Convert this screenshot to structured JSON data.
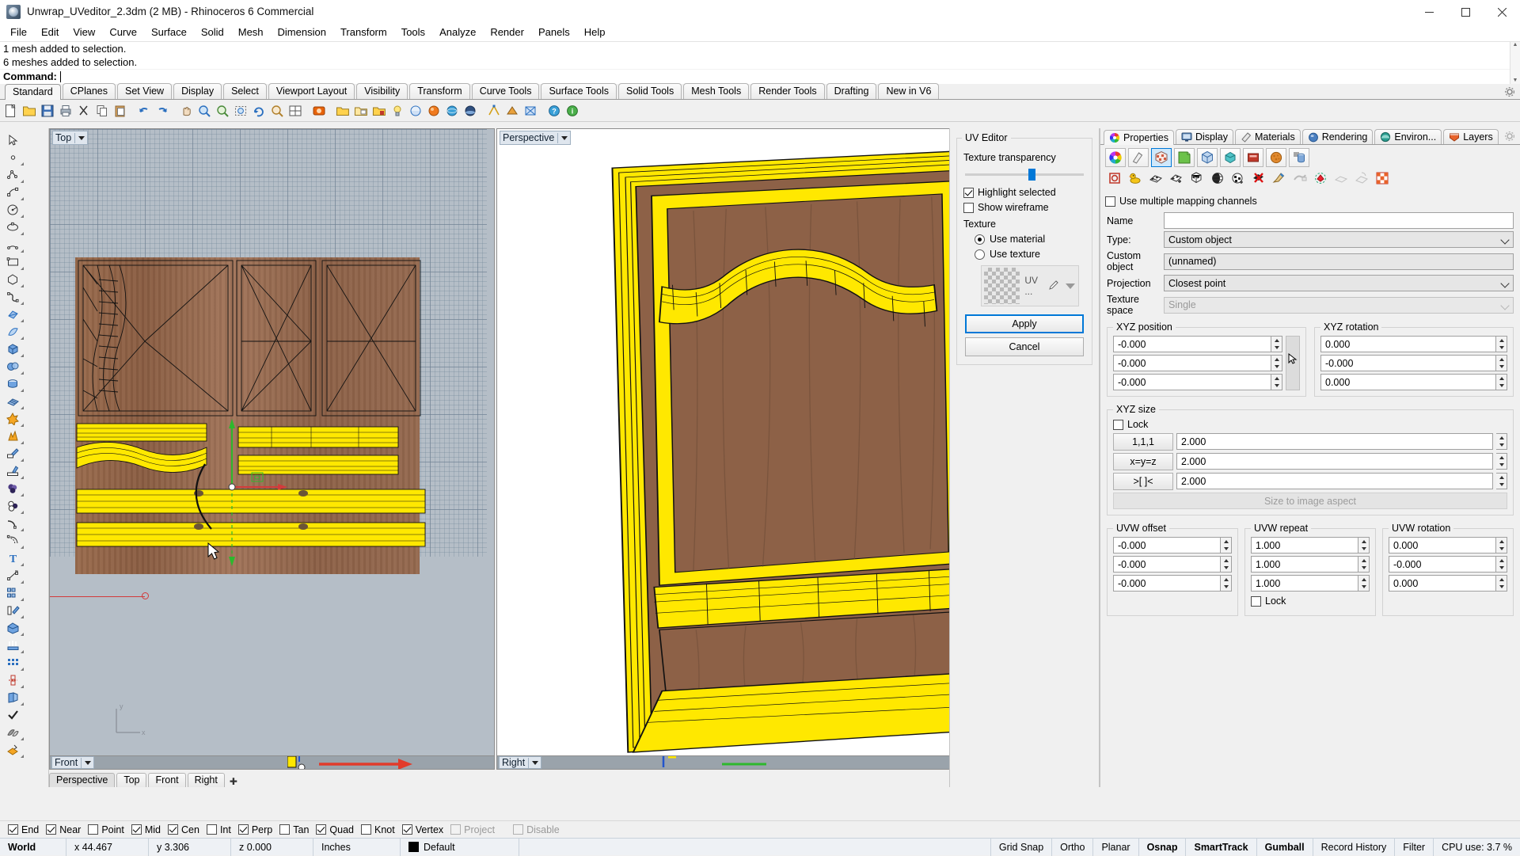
{
  "window": {
    "title": "Unwrap_UVeditor_2.3dm (2 MB) - Rhinoceros 6 Commercial",
    "minimize": "—",
    "maximize": "▭",
    "close": "✕",
    "app_icon": "rhino-logo-icon"
  },
  "menu": [
    "File",
    "Edit",
    "View",
    "Curve",
    "Surface",
    "Solid",
    "Mesh",
    "Dimension",
    "Transform",
    "Tools",
    "Analyze",
    "Render",
    "Panels",
    "Help"
  ],
  "command": {
    "history": [
      "1 mesh added to selection.",
      "6 meshes added to selection."
    ],
    "prompt_label": "Command:",
    "prompt_value": ""
  },
  "toolbar_tabs": [
    {
      "label": "Standard",
      "active": true
    },
    {
      "label": "CPlanes",
      "active": false
    },
    {
      "label": "Set View",
      "active": false
    },
    {
      "label": "Display",
      "active": false
    },
    {
      "label": "Select",
      "active": false
    },
    {
      "label": "Viewport Layout",
      "active": false
    },
    {
      "label": "Visibility",
      "active": false
    },
    {
      "label": "Transform",
      "active": false
    },
    {
      "label": "Curve Tools",
      "active": false
    },
    {
      "label": "Surface Tools",
      "active": false
    },
    {
      "label": "Solid Tools",
      "active": false
    },
    {
      "label": "Mesh Tools",
      "active": false
    },
    {
      "label": "Render Tools",
      "active": false
    },
    {
      "label": "Drafting",
      "active": false
    },
    {
      "label": "New in V6",
      "active": false
    }
  ],
  "viewports": {
    "top_left": {
      "label": "Top"
    },
    "top_right": {
      "label": "Perspective"
    },
    "bottom_left": {
      "label": "Front"
    },
    "bottom_right": {
      "label": "Right"
    },
    "tabs": [
      {
        "label": "Perspective",
        "active": true
      },
      {
        "label": "Top",
        "active": false
      },
      {
        "label": "Front",
        "active": false
      },
      {
        "label": "Right",
        "active": false
      }
    ],
    "add_tab": "✚"
  },
  "uv_editor": {
    "title": "UV Editor",
    "texture_transparency_label": "Texture transparency",
    "texture_transparency_value": 53,
    "highlight_selected": {
      "label": "Highlight selected",
      "checked": true
    },
    "show_wireframe": {
      "label": "Show wireframe",
      "checked": false
    },
    "texture_label": "Texture",
    "use_material": {
      "label": "Use material",
      "selected": true
    },
    "use_texture": {
      "label": "Use texture",
      "selected": false
    },
    "texture_swatch_label": "UV ...",
    "apply_button": "Apply",
    "cancel_button": "Cancel"
  },
  "properties": {
    "tabs": [
      {
        "label": "Properties",
        "icon": "color-wheel-icon",
        "active": true
      },
      {
        "label": "Display",
        "icon": "monitor-icon",
        "active": false
      },
      {
        "label": "Materials",
        "icon": "eraser-icon",
        "active": false
      },
      {
        "label": "Rendering",
        "icon": "sphere-icon",
        "active": false
      },
      {
        "label": "Environ...",
        "icon": "environment-icon",
        "active": false
      },
      {
        "label": "Layers",
        "icon": "layers-icon",
        "active": false
      }
    ],
    "gear_icon": "gear-icon",
    "icon_row_1": [
      {
        "name": "color-wheel-icon",
        "selected": false
      },
      {
        "name": "material-brush-icon",
        "selected": false
      },
      {
        "name": "texture-mapping-icon",
        "selected": true
      },
      {
        "name": "display-page-icon",
        "selected": false
      },
      {
        "name": "object-box-icon",
        "selected": false
      },
      {
        "name": "mesh-icon",
        "selected": false
      },
      {
        "name": "light-box-icon",
        "selected": false
      },
      {
        "name": "texture-ball-icon",
        "selected": false
      },
      {
        "name": "cylinder-detail-icon",
        "selected": false
      }
    ],
    "icon_row_2": [
      "mapping-widget-icon",
      "duck-surface-icon",
      "planar-mapping-icon",
      "box-mapping-icon",
      "cube-mapping-icon",
      "spherical-mapping-icon",
      "cylindrical-mapping-icon",
      "remove-mapping-icon",
      "paint-mapping-icon",
      "unwrap-icon",
      "uv-editor-icon",
      "flatten-icon",
      "apply-uv-icon",
      "checker-icon"
    ],
    "use_multiple_channels": {
      "label": "Use multiple mapping channels",
      "checked": false
    },
    "fields": {
      "name_label": "Name",
      "name_value": "",
      "name_placeholder": "",
      "type_label": "Type:",
      "type_value": "Custom object",
      "custom_object_label": "Custom object",
      "custom_object_value": "(unnamed)",
      "projection_label": "Projection",
      "projection_value": "Closest point",
      "texture_space_label": "Texture space",
      "texture_space_value": "Single",
      "texture_space_disabled": true
    },
    "xyz_position": {
      "title": "XYZ position",
      "values": [
        "-0.000",
        "-0.000",
        "-0.000"
      ]
    },
    "xyz_rotation": {
      "title": "XYZ rotation",
      "values": [
        "0.000",
        "-0.000",
        "0.000"
      ]
    },
    "xyz_size": {
      "title": "XYZ size",
      "lock_label": "Lock",
      "lock_checked": false,
      "buttons": [
        "1,1,1",
        "x=y=z",
        ">[ ]<"
      ],
      "values": [
        "2.000",
        "2.000",
        "2.000"
      ],
      "size_to_aspect": "Size to image aspect"
    },
    "uvw_offset": {
      "title": "UVW offset",
      "values": [
        "-0.000",
        "-0.000",
        "-0.000"
      ]
    },
    "uvw_repeat": {
      "title": "UVW repeat",
      "values": [
        "1.000",
        "1.000",
        "1.000"
      ],
      "lock_label": "Lock",
      "lock_checked": false
    },
    "uvw_rotation": {
      "title": "UVW rotation",
      "values": [
        "0.000",
        "-0.000",
        "0.000"
      ]
    }
  },
  "osnap": [
    {
      "label": "End",
      "checked": true,
      "disabled": false
    },
    {
      "label": "Near",
      "checked": true,
      "disabled": false
    },
    {
      "label": "Point",
      "checked": false,
      "disabled": false
    },
    {
      "label": "Mid",
      "checked": true,
      "disabled": false
    },
    {
      "label": "Cen",
      "checked": true,
      "disabled": false
    },
    {
      "label": "Int",
      "checked": false,
      "disabled": false
    },
    {
      "label": "Perp",
      "checked": true,
      "disabled": false
    },
    {
      "label": "Tan",
      "checked": false,
      "disabled": false
    },
    {
      "label": "Quad",
      "checked": true,
      "disabled": false
    },
    {
      "label": "Knot",
      "checked": false,
      "disabled": false
    },
    {
      "label": "Vertex",
      "checked": true,
      "disabled": false
    },
    {
      "label": "Project",
      "checked": false,
      "disabled": true
    },
    {
      "label": "Disable",
      "checked": false,
      "disabled": true
    }
  ],
  "status": {
    "cplane": "World",
    "x": "x 44.467",
    "y": "y 3.306",
    "z": "z 0.000",
    "units": "Inches",
    "layer": "Default",
    "layer_color": "#000000",
    "right_items": [
      {
        "label": "Grid Snap",
        "on": false
      },
      {
        "label": "Ortho",
        "on": false
      },
      {
        "label": "Planar",
        "on": false
      },
      {
        "label": "Osnap",
        "on": true
      },
      {
        "label": "SmartTrack",
        "on": true
      },
      {
        "label": "Gumball",
        "on": true
      },
      {
        "label": "Record History",
        "on": false
      },
      {
        "label": "Filter",
        "on": false
      },
      {
        "label": "CPU use: 3.7 %",
        "on": false
      }
    ]
  },
  "colors": {
    "accent": "#0078d7",
    "viewport_bg": "#b5bec7",
    "perspective_bg": "#ffffff",
    "selection_yellow": "#ffe800",
    "wood": "#8d6147",
    "axis_red": "#d23b3b"
  }
}
